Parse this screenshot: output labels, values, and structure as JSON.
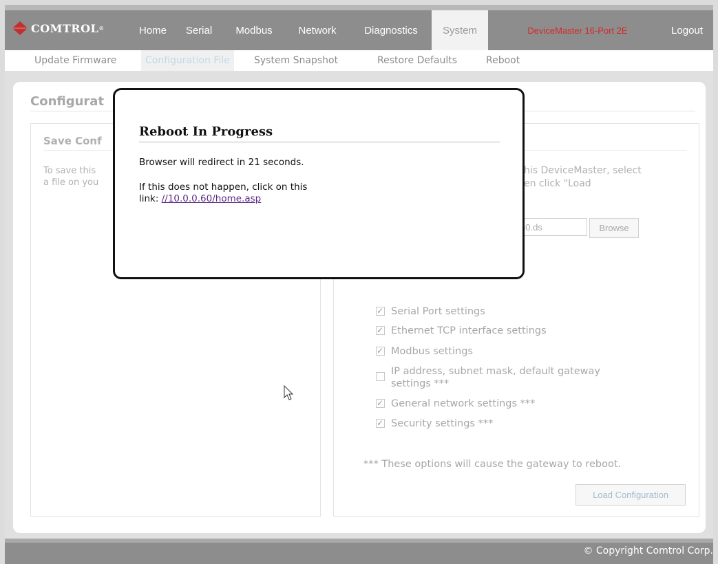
{
  "brand": {
    "logo_text": "COMTROL",
    "registered": "®",
    "accent_color": "#c03030"
  },
  "topnav": {
    "home": "Home",
    "serial": "Serial",
    "modbus": "Modbus",
    "network": "Network",
    "diagnostics": "Diagnostics",
    "system": "System",
    "device": "DeviceMaster 16-Port 2E",
    "logout": "Logout"
  },
  "subnav": {
    "update_firmware": "Update Firmware",
    "configuration_file": "Configuration File",
    "system_snapshot": "System Snapshot",
    "restore_defaults": "Restore Defaults",
    "reboot": "Reboot"
  },
  "page": {
    "title": "Configurat",
    "save_panel": {
      "title": "Save Conf",
      "text_line1": "To save this",
      "text_line2": "a file on you"
    },
    "load_panel": {
      "text_line1": "his DeviceMaster, select",
      "text_line2": "en click \"Load",
      "file_value": "60.ds",
      "browse_label": "Browse",
      "options": [
        {
          "label": "Serial Port settings",
          "checked": true
        },
        {
          "label": "Ethernet TCP interface settings",
          "checked": true
        },
        {
          "label": "Modbus settings",
          "checked": true
        },
        {
          "label": "IP address, subnet mask, default gateway",
          "label2": "settings ***",
          "checked": false
        },
        {
          "label": "General network settings ***",
          "checked": true
        },
        {
          "label": "Security settings ***",
          "checked": true
        }
      ],
      "note": "*** These options will cause the gateway to reboot.",
      "load_button": "Load Configuration"
    }
  },
  "modal": {
    "title": "Reboot In Progress",
    "redirect_text": "Browser will redirect in 21 seconds.",
    "fallback_line1": "If this does not happen, click on this",
    "fallback_prefix": "link: ",
    "link_text": "//10.0.0.60/home.asp"
  },
  "footer": {
    "copyright": "© Copyright Comtrol Corp."
  }
}
